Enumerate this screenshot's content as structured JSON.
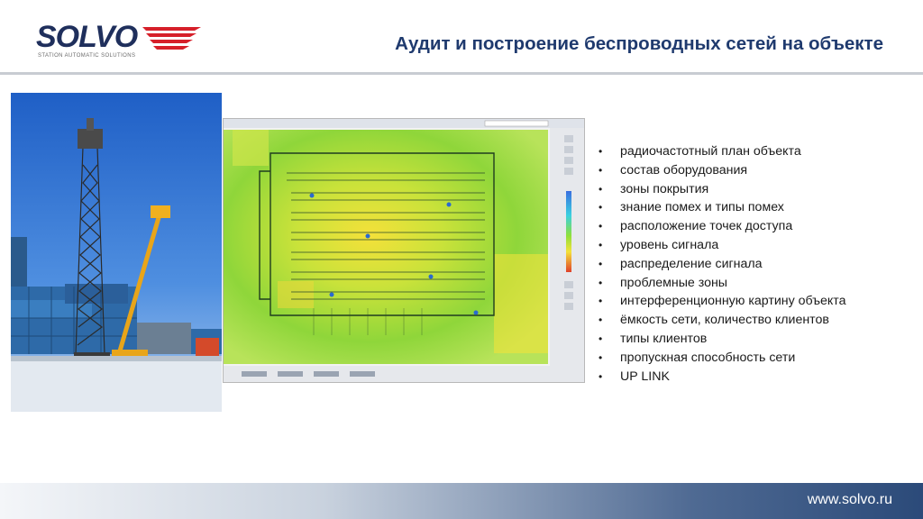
{
  "header": {
    "logo_text": "SOLVO",
    "logo_subtitle": "STATION AUTOMATIC SOLUTIONS",
    "title": "Аудит и построение беспроводных сетей на объекте"
  },
  "bullets": [
    "радиочастотный план объекта",
    "состав оборудования",
    "зоны покрытия",
    "знание помех и типы помех",
    "расположение точек доступа",
    "уровень сигнала",
    "распределение сигнала",
    "проблемные зоны",
    "интерференционную картину объекта",
    "ёмкость сети, количество клиентов",
    "типы клиентов",
    "пропускная способность сети",
    "UP LINK"
  ],
  "bullet_symbol": "•",
  "footer": {
    "url": "www.solvo.ru"
  },
  "colors": {
    "title": "#1f3a6e",
    "logo_navy": "#1f2f5c",
    "logo_red": "#d6202a",
    "footer_dark": "#2b4a79"
  }
}
